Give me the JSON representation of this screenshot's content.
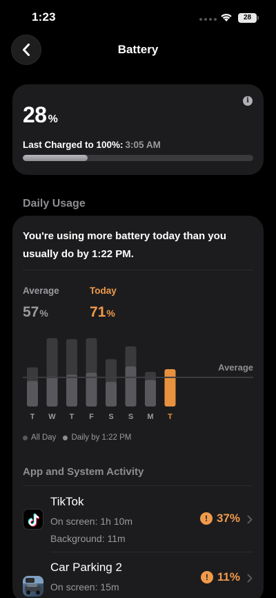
{
  "status_bar": {
    "time": "1:23",
    "battery_level": "28"
  },
  "nav": {
    "title": "Battery",
    "back_icon": "chevron-left-icon"
  },
  "battery": {
    "level_value": "28",
    "level_unit": "%",
    "last_charged_label": "Last Charged to 100%:",
    "last_charged_time": "3:05 AM",
    "charge_fraction": 0.28
  },
  "daily_usage": {
    "section_title": "Daily Usage",
    "message": "You're using more battery today than you usually do by 1:22 PM.",
    "average_label": "Average",
    "average_value": "57",
    "today_label": "Today",
    "today_value": "71",
    "unit": "%",
    "average_line_label": "Average",
    "legend": {
      "all_day": "All Day",
      "by_time": "Daily by 1:22 PM"
    }
  },
  "chart_data": {
    "type": "bar",
    "categories": [
      "T",
      "W",
      "T",
      "F",
      "S",
      "S",
      "M",
      "T"
    ],
    "series": [
      {
        "name": "All Day",
        "values": [
          43,
          75,
          74,
          75,
          52,
          66,
          38,
          0
        ]
      },
      {
        "name": "Daily by 1:22 PM",
        "values": [
          28,
          33,
          35,
          37,
          27,
          44,
          29,
          41
        ]
      }
    ],
    "average_line": 32,
    "ylim": [
      0,
      85
    ],
    "highlight_index": 7,
    "colors": {
      "all_day": "#3a3a3c",
      "by_time": "#58585c",
      "today": "#e8913f",
      "average_line": "#3d3d40"
    }
  },
  "activity": {
    "title": "App and System Activity",
    "apps": [
      {
        "name": "TikTok",
        "on_screen": "On screen: 1h 10m",
        "background": "Background: 11m",
        "percent": "37%",
        "icon": "tiktok-icon"
      },
      {
        "name": "Car Parking 2",
        "on_screen": "On screen: 15m",
        "percent": "11%",
        "icon": "car-parking-icon"
      }
    ]
  },
  "colors": {
    "accent_orange": "#f09a4b",
    "card_bg": "#1c1c1e",
    "secondary_text": "#8e8e93"
  }
}
